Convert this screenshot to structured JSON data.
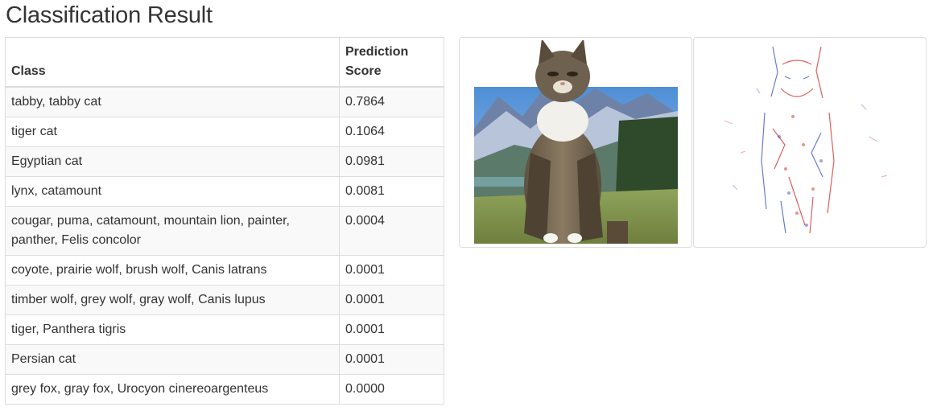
{
  "page": {
    "title": "Classification Result"
  },
  "table": {
    "headers": {
      "class": "Class",
      "score": "Prediction Score"
    },
    "rows": [
      {
        "class": "tabby, tabby cat",
        "score": "0.7864"
      },
      {
        "class": "tiger cat",
        "score": "0.1064"
      },
      {
        "class": "Egyptian cat",
        "score": "0.0981"
      },
      {
        "class": "lynx, catamount",
        "score": "0.0081"
      },
      {
        "class": "cougar, puma, catamount, mountain lion, painter, panther, Felis concolor",
        "score": "0.0004"
      },
      {
        "class": "coyote, prairie wolf, brush wolf, Canis latrans",
        "score": "0.0001"
      },
      {
        "class": "timber wolf, grey wolf, gray wolf, Canis lupus",
        "score": "0.0001"
      },
      {
        "class": "tiger, Panthera tigris",
        "score": "0.0001"
      },
      {
        "class": "Persian cat",
        "score": "0.0001"
      },
      {
        "class": "grey fox, gray fox, Urocyon cinereoargenteus",
        "score": "0.0000"
      }
    ]
  },
  "images": {
    "input": "photo of a tabby cat sitting on a post",
    "saliency": "saliency map of the cat image"
  },
  "colors": {
    "text": "#333333",
    "border": "#dddddd",
    "stripe": "#f9f9f9",
    "saliency_red": "#d62728",
    "saliency_blue": "#3b4cc0"
  }
}
